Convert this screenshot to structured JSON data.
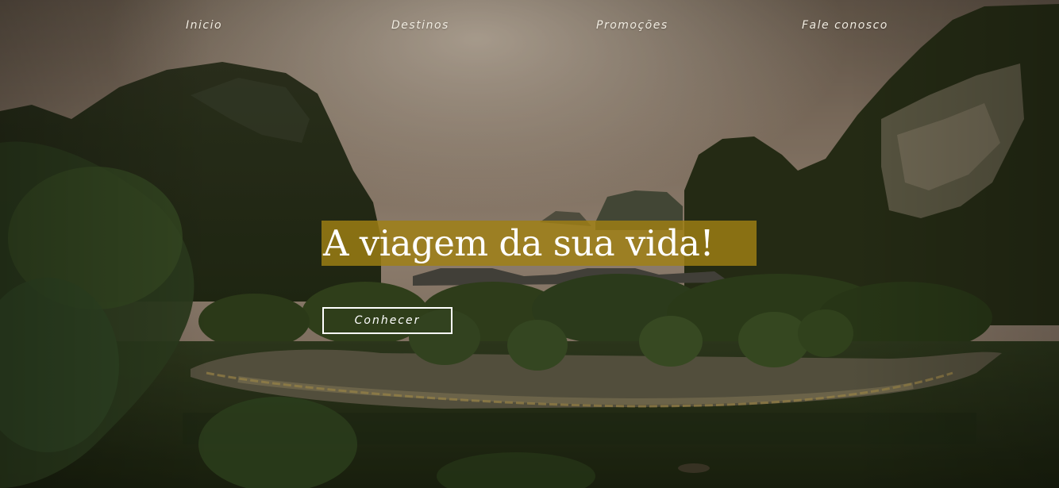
{
  "nav": {
    "items": [
      {
        "label": "Inicio"
      },
      {
        "label": "Destinos"
      },
      {
        "label": "Promoções"
      },
      {
        "label": "Fale conosco"
      }
    ]
  },
  "hero": {
    "headline": "A viagem da sua vida!",
    "cta_label": "Conhecer",
    "accent_color": "#a08014"
  }
}
